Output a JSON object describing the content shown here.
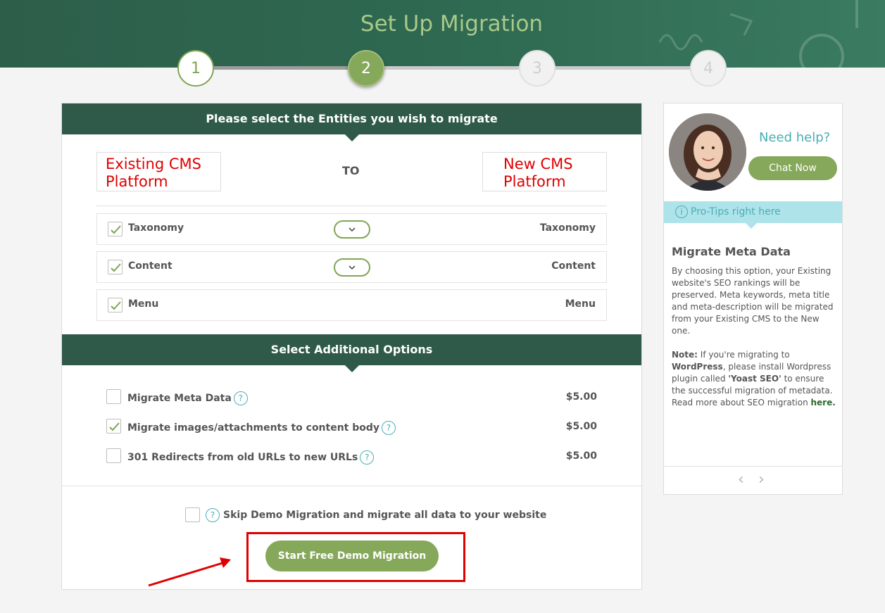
{
  "header": {
    "title": "Set Up Migration"
  },
  "steps": [
    "1",
    "2",
    "3",
    "4"
  ],
  "entities_section": {
    "heading": "Please select the Entities you wish to migrate",
    "source_platform": "Existing CMS Platform",
    "to_label": "TO",
    "target_platform": "New CMS Platform",
    "rows": [
      {
        "source": "Taxonomy",
        "target": "Taxonomy",
        "checked": true,
        "has_toggle": true
      },
      {
        "source": "Content",
        "target": "Content",
        "checked": true,
        "has_toggle": true
      },
      {
        "source": "Menu",
        "target": "Menu",
        "checked": true,
        "has_toggle": false
      }
    ]
  },
  "options_section": {
    "heading": "Select Additional Options",
    "options": [
      {
        "label": "Migrate Meta Data",
        "price": "$5.00",
        "checked": false
      },
      {
        "label": "Migrate images/attachments to content body",
        "price": "$5.00",
        "checked": true
      },
      {
        "label": "301 Redirects from old URLs to new URLs",
        "price": "$5.00",
        "checked": false
      }
    ]
  },
  "skip": {
    "label": "Skip Demo Migration and migrate all data to your website",
    "checked": false
  },
  "cta": {
    "label": "Start Free Demo Migration"
  },
  "sidebar": {
    "need_help": "Need help?",
    "chat_label": "Chat Now",
    "pro_tips": "Pro-Tips right here",
    "tip_title": "Migrate Meta Data",
    "tip_p1": "By choosing this option, your Existing website's SEO rankings will be preserved. Meta keywords, meta title and meta-description will be migrated from your Existing CMS to the New one.",
    "note_label": "Note:",
    "note_t1": " If you're migrating to ",
    "note_wp": "WordPress",
    "note_t2": ", please install Wordpress plugin called ",
    "note_plugin": "'Yoast SEO'",
    "note_t3": " to ensure the successful migration of metadata.",
    "read_more": "Read more about SEO migration ",
    "here": "here."
  },
  "icons": {
    "check": "checkmark-icon",
    "question": "question-icon",
    "info": "info-icon",
    "chevron": "chevron-down-icon",
    "prev": "chevron-left-icon",
    "next": "chevron-right-icon"
  },
  "colors": {
    "header_bg": "#2f6a52",
    "band_bg": "#2f5a49",
    "accent_green": "#86a85a",
    "teal": "#4aaeb3",
    "tip_bg": "#aee3ea",
    "annotation_red": "#e00000"
  }
}
